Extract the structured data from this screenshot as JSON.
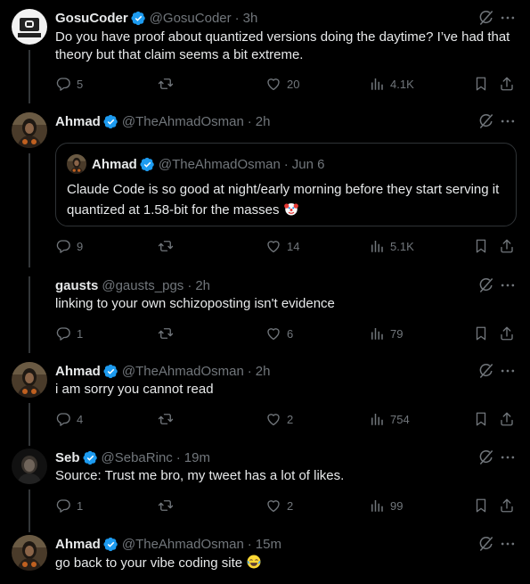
{
  "tweets": [
    {
      "name": "GosuCoder",
      "handle": "@GosuCoder",
      "time": "3h",
      "text": "Do you have proof about quantized versions doing the daytime? I’ve had that theory but that claim seems a bit extreme.",
      "replies": "5",
      "retweets": "",
      "likes": "20",
      "views": "4.1K"
    },
    {
      "name": "Ahmad",
      "handle": "@TheAhmadOsman",
      "time": "2h",
      "text": "",
      "replies": "9",
      "retweets": "",
      "likes": "14",
      "views": "5.1K",
      "quote": {
        "name": "Ahmad",
        "handle": "@TheAhmadOsman",
        "time": "Jun 6",
        "text": "Claude Code is so good at night/early morning before they start serving it quantized at 1.58-bit for the masses"
      }
    },
    {
      "name": "gausts",
      "handle": "@gausts_pgs",
      "time": "2h",
      "text": "linking to your own schizoposting isn't evidence",
      "replies": "1",
      "retweets": "",
      "likes": "6",
      "views": "79"
    },
    {
      "name": "Ahmad",
      "handle": "@TheAhmadOsman",
      "time": "2h",
      "text": "i am sorry you cannot read",
      "replies": "4",
      "retweets": "",
      "likes": "2",
      "views": "754"
    },
    {
      "name": "Seb",
      "handle": "@SebaRinc",
      "time": "19m",
      "text": "Source: Trust me bro, my tweet has a lot of likes.",
      "replies": "1",
      "retweets": "",
      "likes": "2",
      "views": "99"
    },
    {
      "name": "Ahmad",
      "handle": "@TheAhmadOsman",
      "time": "15m",
      "text": "go back to your vibe coding site"
    }
  ],
  "separator": "·",
  "colors": {
    "background": "#000000",
    "text": "#e7e9ea",
    "muted": "#71767b",
    "verified": "#1d9bf0",
    "border": "#2f3336"
  },
  "icons": {
    "verified": "verified-badge-icon",
    "grok": "grok-icon",
    "more": "more-icon",
    "reply": "reply-icon",
    "retweet": "retweet-icon",
    "like": "like-icon",
    "views": "views-icon",
    "bookmark": "bookmark-icon",
    "share": "share-icon"
  }
}
